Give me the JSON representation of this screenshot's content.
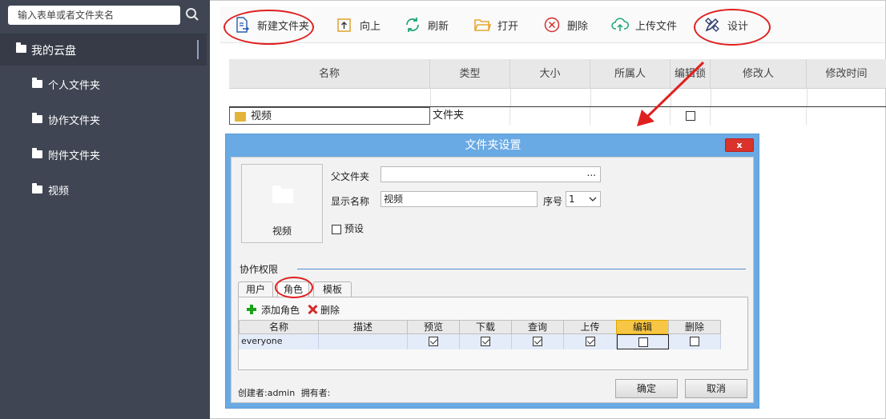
{
  "sidebar": {
    "search_placeholder": "输入表单或者文件夹名",
    "root_label": "我的云盘",
    "items": [
      "个人文件夹",
      "协作文件夹",
      "附件文件夹",
      "视频"
    ]
  },
  "toolbar": {
    "new_folder": "新建文件夹",
    "up": "向上",
    "refresh": "刷新",
    "open": "打开",
    "delete": "删除",
    "upload": "上传文件",
    "design": "设计"
  },
  "table": {
    "headers": [
      "名称",
      "类型",
      "大小",
      "所属人",
      "编辑锁",
      "修改人",
      "修改时间"
    ],
    "rows": [
      {
        "name": "视频",
        "type": "文件夹"
      }
    ]
  },
  "dialog": {
    "title": "文件夹设置",
    "close": "x",
    "preview_caption": "视频",
    "parent_label": "父文件夹",
    "parent_value": "",
    "parent_browse": "...",
    "display_name_label": "显示名称",
    "display_name_value": "视频",
    "order_label": "序号",
    "order_value": "1",
    "preset_label": "预设",
    "section_label": "协作权限",
    "tabs": [
      "用户",
      "角色",
      "模板"
    ],
    "add_role": "添加角色",
    "delete": "删除",
    "grid_headers": [
      "名称",
      "描述",
      "预览",
      "下载",
      "查询",
      "上传",
      "编辑",
      "删除"
    ],
    "grid_row": {
      "name": "everyone",
      "desc": "",
      "preview": true,
      "download": true,
      "query": true,
      "upload": true,
      "edit": false,
      "delete": false
    },
    "creator": "创建者:admin",
    "owner": "拥有者:",
    "ok": "确定",
    "cancel": "取消"
  },
  "colors": {
    "sidebar_bg": "#3f4552",
    "dialog_title_bg": "#6aaae4",
    "annotation_red": "#e02020",
    "highlight_header": "#f7c645"
  }
}
